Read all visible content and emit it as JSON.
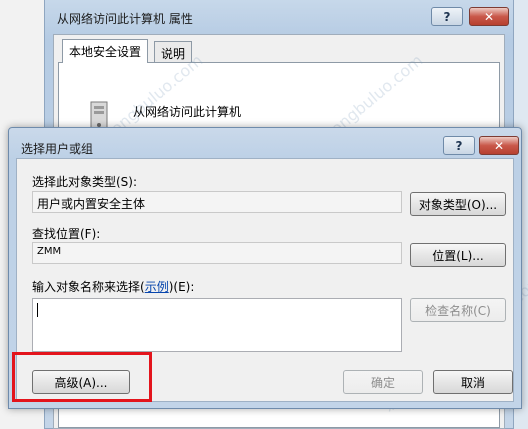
{
  "background_window": {
    "title": "从网络访问此计算机 属性",
    "help_label": "?",
    "close_label": "✕",
    "tabs": [
      {
        "label": "本地安全设置"
      },
      {
        "label": "说明"
      }
    ],
    "policy_name": "从网络访问此计算机"
  },
  "dialog": {
    "title": "选择用户或组",
    "help_label": "?",
    "close_label": "✕",
    "object_type_label": "选择此对象类型(S):",
    "object_type_value": "用户或内置安全主体",
    "object_types_button": "对象类型(O)...",
    "location_label": "查找位置(F):",
    "location_value": "ZMM",
    "locations_button": "位置(L)...",
    "enter_names_prefix": "输入对象名称来选择(",
    "examples_link": "示例",
    "enter_names_suffix": ")(E):",
    "check_names_button": "检查名称(C)",
    "advanced_button": "高级(A)...",
    "ok_button": "确定",
    "cancel_button": "取消"
  },
  "colors": {
    "highlight": "#e3141c",
    "link": "#0645ad"
  }
}
